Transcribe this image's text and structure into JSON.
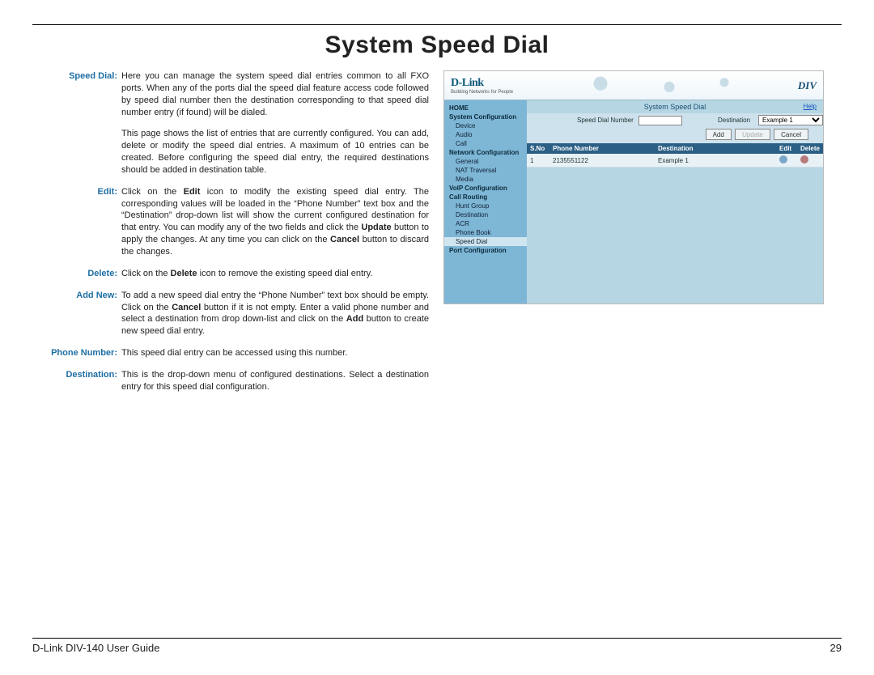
{
  "page_title": "System Speed Dial",
  "definitions": [
    {
      "label": "Speed Dial:",
      "paragraphs": [
        "Here you can manage the system speed dial entries common to all FXO ports. When any of the ports dial the speed dial feature access code followed by speed dial number then the destination corresponding to that speed dial number entry (if found) will be dialed.",
        "This page shows the list of entries that are currently configured. You can add, delete or modify the speed dial entries. A maximum of 10 entries can be created. Before configuring the speed dial entry, the required destinations should be added in destination table."
      ]
    },
    {
      "label": "Edit:",
      "paragraphs": [
        "Click on the <b>Edit</b> icon to modify the existing speed dial entry. The corresponding values will be loaded in the “Phone Number” text box and the “Destination” drop-down list will show the current configured destination for that entry. You can modify any of the two fields and click the <b>Update</b> button to apply the changes. At any time you can click on the <b>Cancel</b> button to discard the changes."
      ]
    },
    {
      "label": "Delete:",
      "paragraphs": [
        "Click on the <b>Delete</b> icon to remove the existing speed dial entry."
      ]
    },
    {
      "label": "Add New:",
      "paragraphs": [
        "To add a new speed dial entry the “Phone Number” text box should be empty. Click on the <b>Cancel</b> button if it is not empty. Enter a valid phone number and select a destination from drop down-list and click on the <b>Add</b> button to create new speed dial entry."
      ]
    },
    {
      "label": "Phone Number:",
      "paragraphs": [
        "This speed dial entry can be accessed using this number."
      ]
    },
    {
      "label": "Destination:",
      "paragraphs": [
        "This is the drop-down menu of configured destinations. Select a destination entry for this speed dial configuration."
      ]
    }
  ],
  "screenshot": {
    "brand": "D-Link",
    "brand_tagline": "Building Networks for People",
    "product_code": "DIV",
    "nav": [
      {
        "label": "HOME",
        "type": "item"
      },
      {
        "label": "System Configuration",
        "type": "item"
      },
      {
        "label": "Device",
        "type": "sub"
      },
      {
        "label": "Audio",
        "type": "sub"
      },
      {
        "label": "Call",
        "type": "sub"
      },
      {
        "label": "Network Configuration",
        "type": "item"
      },
      {
        "label": "General",
        "type": "sub"
      },
      {
        "label": "NAT Traversal",
        "type": "sub"
      },
      {
        "label": "Media",
        "type": "sub"
      },
      {
        "label": "VoIP Configuration",
        "type": "item"
      },
      {
        "label": "Call Routing",
        "type": "item"
      },
      {
        "label": "Hunt Group",
        "type": "sub"
      },
      {
        "label": "Destination",
        "type": "sub"
      },
      {
        "label": "ACR",
        "type": "sub"
      },
      {
        "label": "Phone Book",
        "type": "sub"
      },
      {
        "label": "Speed Dial",
        "type": "sub",
        "active": true
      },
      {
        "label": "Port Configuration",
        "type": "item"
      }
    ],
    "section_title": "System Speed Dial",
    "help_label": "Help",
    "form": {
      "speed_dial_label": "Speed Dial Number",
      "speed_dial_value": "",
      "destination_label": "Destination",
      "destination_value": "Example 1",
      "buttons": {
        "add": "Add",
        "update": "Update",
        "cancel": "Cancel"
      }
    },
    "table": {
      "headers": [
        "S.No",
        "Phone Number",
        "Destination",
        "Edit",
        "Delete"
      ],
      "rows": [
        {
          "sno": "1",
          "phone": "2135551122",
          "dest": "Example 1"
        }
      ]
    }
  },
  "footer": {
    "guide": "D-Link DIV-140 User Guide",
    "page_number": "29"
  }
}
